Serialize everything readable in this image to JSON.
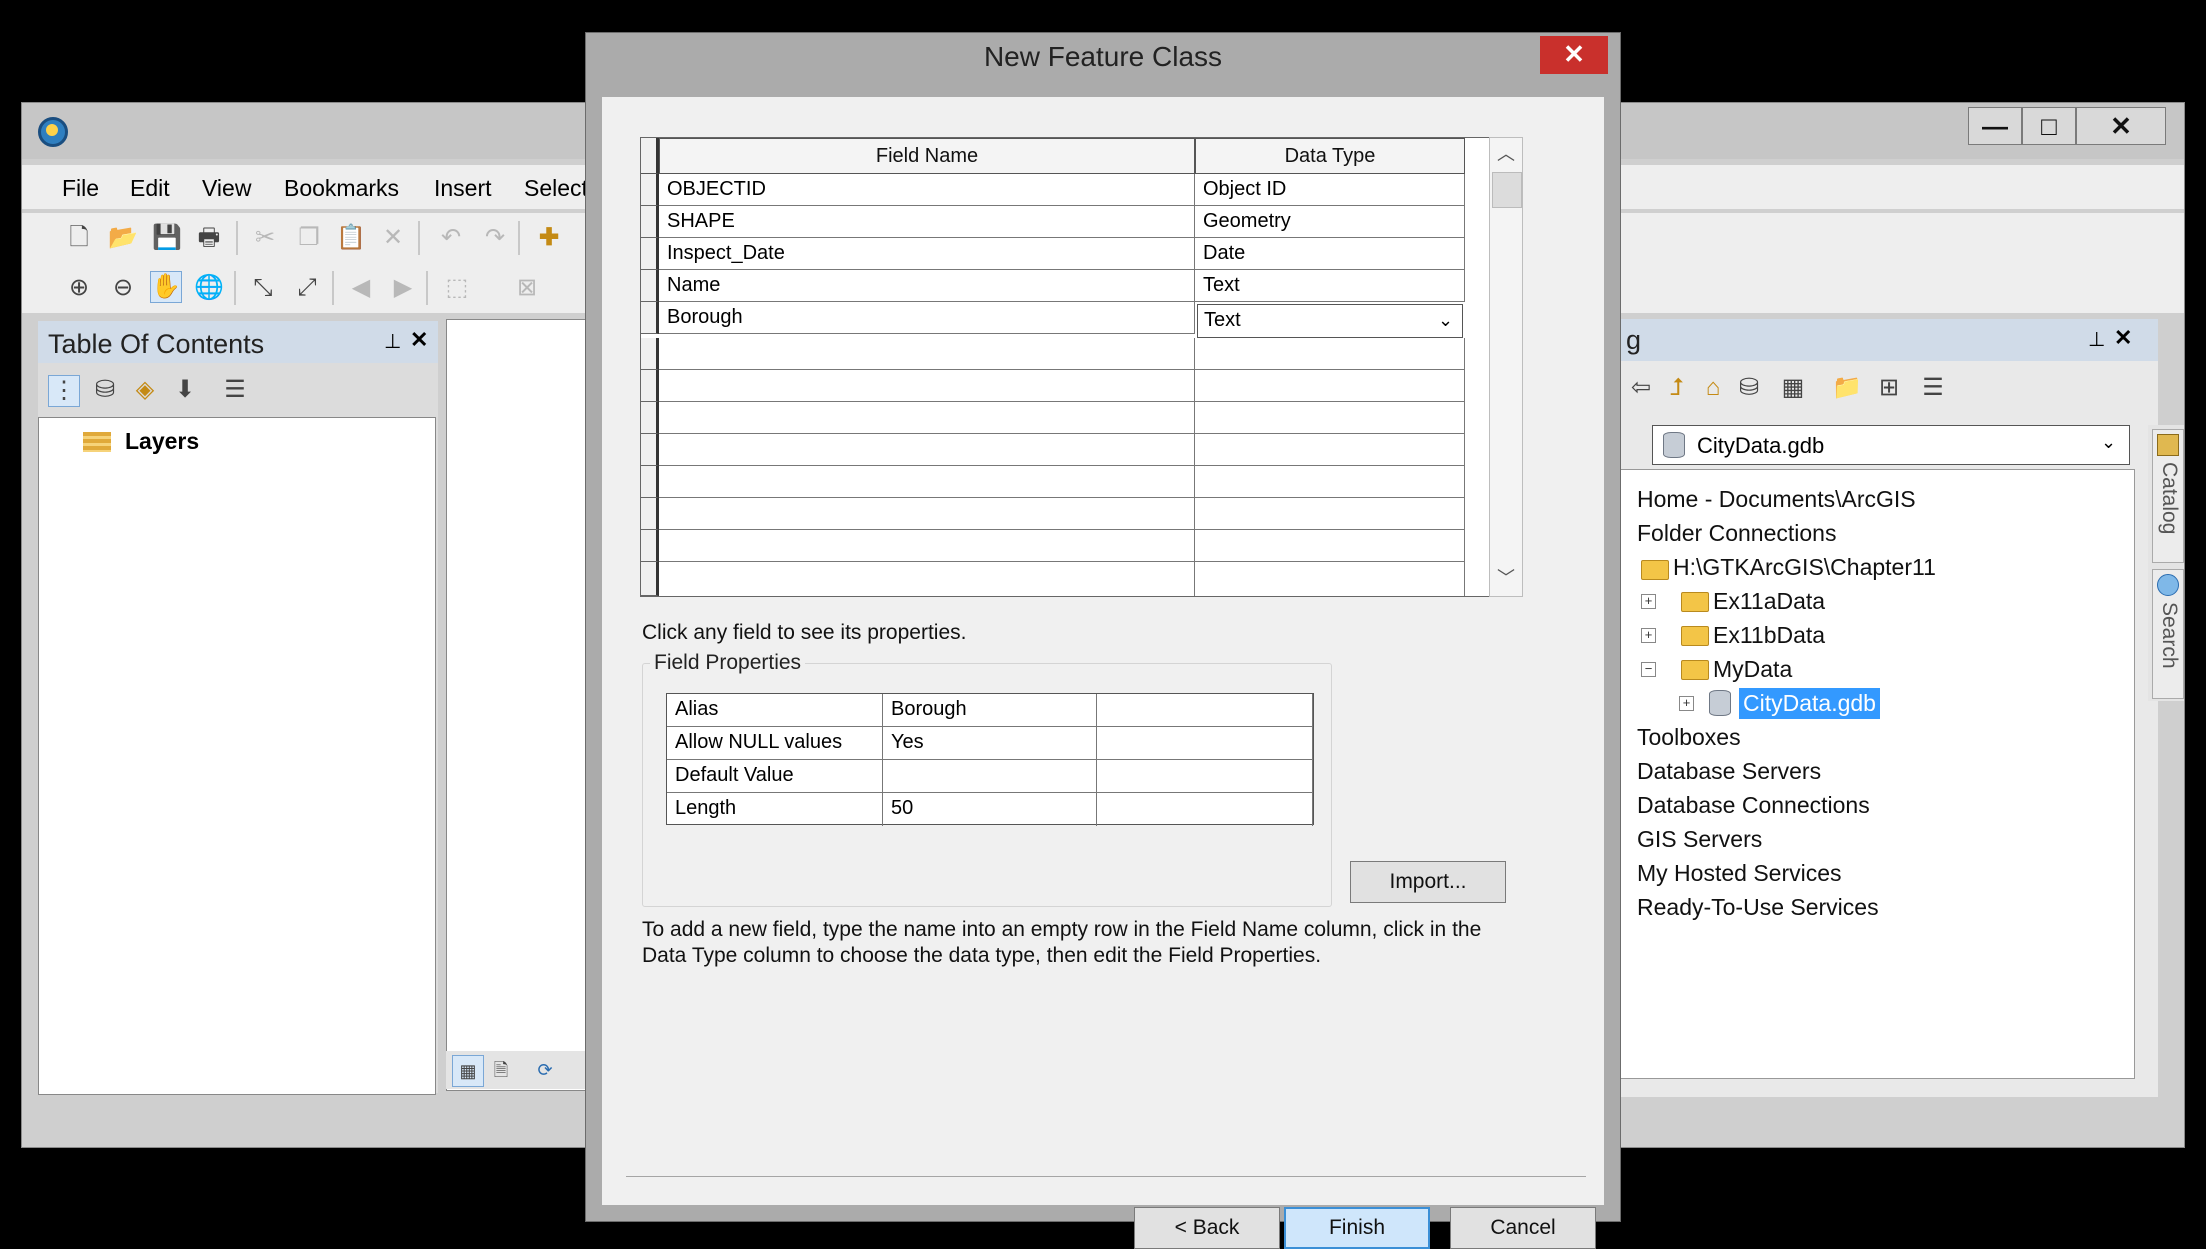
{
  "app": {
    "menu": [
      "File",
      "Edit",
      "View",
      "Bookmarks",
      "Insert",
      "Select"
    ],
    "window_buttons": {
      "minimize": "—",
      "maximize": "□",
      "close": "✕"
    }
  },
  "toc": {
    "title": "Table Of Contents",
    "pin": "⊥",
    "close": "✕",
    "layers_label": "Layers"
  },
  "catalog": {
    "title_fragment": "g",
    "location": "CityData.gdb",
    "tree": [
      {
        "label": "Home - Documents\\ArcGIS"
      },
      {
        "label": "Folder Connections"
      },
      {
        "label": "H:\\GTKArcGIS\\Chapter11"
      },
      {
        "label": "Ex11aData",
        "expander": "+"
      },
      {
        "label": "Ex11bData",
        "expander": "+"
      },
      {
        "label": "MyData",
        "expander": "−"
      },
      {
        "label": "CityData.gdb",
        "expander": "+",
        "selected": true
      },
      {
        "label": "Toolboxes"
      },
      {
        "label": "Database Servers"
      },
      {
        "label": "Database Connections"
      },
      {
        "label": "GIS Servers"
      },
      {
        "label": "My Hosted Services"
      },
      {
        "label": "Ready-To-Use Services"
      }
    ],
    "side_tabs": [
      "Catalog",
      "Search"
    ]
  },
  "dialog": {
    "title": "New Feature Class",
    "close": "✕",
    "grid": {
      "headers": [
        "Field Name",
        "Data Type"
      ],
      "rows": [
        [
          "OBJECTID",
          "Object ID"
        ],
        [
          "SHAPE",
          "Geometry"
        ],
        [
          "Inspect_Date",
          "Date"
        ],
        [
          "Name",
          "Text"
        ],
        [
          "Borough",
          "Text"
        ]
      ]
    },
    "hint": "Click any field to see its properties.",
    "field_properties": {
      "title": "Field Properties",
      "rows": [
        [
          "Alias",
          "Borough"
        ],
        [
          "Allow NULL values",
          "Yes"
        ],
        [
          "Default Value",
          ""
        ],
        [
          "Length",
          "50"
        ]
      ]
    },
    "import_button": "Import...",
    "instructions": "To add a new field, type the name into an empty row in the Field Name column, click in the Data Type column to choose the data type, then edit the Field Properties.",
    "buttons": {
      "back": "< Back",
      "finish": "Finish",
      "cancel": "Cancel"
    }
  },
  "colors": {
    "selection": "#3399ff",
    "close_red": "#c9302c",
    "finish_border": "#3b8fd6"
  }
}
